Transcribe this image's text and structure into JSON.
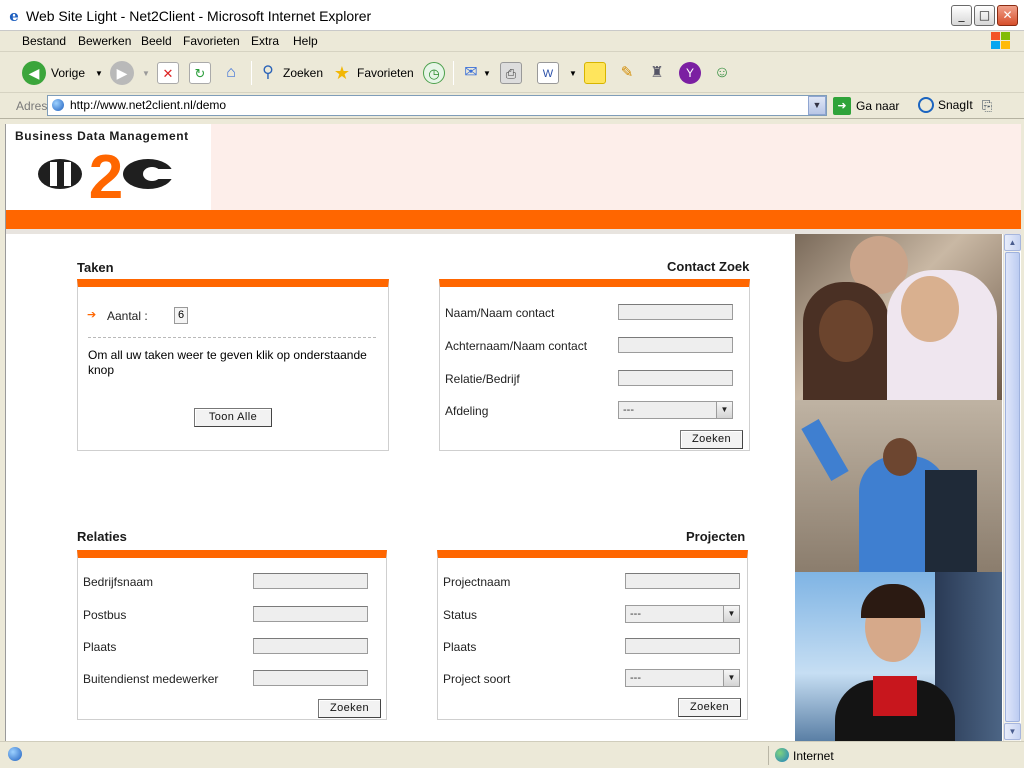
{
  "window": {
    "title": "Web Site Light - Net2Client - Microsoft Internet Explorer",
    "minimize": "_",
    "maximize": "□",
    "close": "✕"
  },
  "menu": [
    "Bestand",
    "Bewerken",
    "Beeld",
    "Favorieten",
    "Extra",
    "Help"
  ],
  "toolbar": {
    "back_label": "Vorige",
    "search_label": "Zoeken",
    "favorites_label": "Favorieten"
  },
  "address": {
    "label": "Adres",
    "url": "http://www.net2client.nl/demo",
    "go_label": "Ga naar",
    "snagit_label": "SnagIt"
  },
  "brand": {
    "caption": "Business Data Management",
    "logo_text": "N2C",
    "colors": {
      "accent": "#ff6600",
      "header_band": "#fdeeea"
    }
  },
  "taken": {
    "title": "Taken",
    "count_label": "Aantal :",
    "count_value": "6",
    "description": "Om all uw taken weer te geven klik op onderstaande knop",
    "button": "Toon Alle"
  },
  "contact": {
    "title": "Contact Zoek",
    "fields": [
      "Naam/Naam contact",
      "Achternaam/Naam contact",
      "Relatie/Bedrijf"
    ],
    "select_label": "Afdeling",
    "select_value": "---",
    "button": "Zoeken"
  },
  "relaties": {
    "title": "Relaties",
    "fields": [
      "Bedrijfsnaam",
      "Postbus",
      "Plaats",
      "Buitendienst medewerker"
    ],
    "button": "Zoeken"
  },
  "projecten": {
    "title": "Projecten",
    "label_projectnaam": "Projectnaam",
    "label_status": "Status",
    "status_value": "---",
    "label_plaats": "Plaats",
    "label_soort": "Project soort",
    "soort_value": "---",
    "button": "Zoeken"
  },
  "status": {
    "zone": "Internet"
  }
}
